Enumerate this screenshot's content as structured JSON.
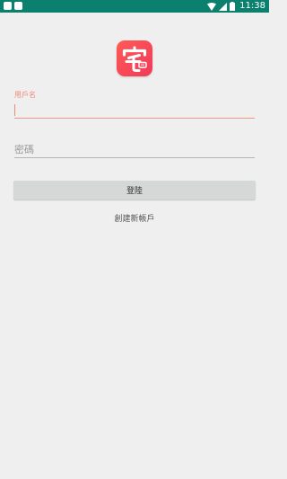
{
  "status_bar": {
    "time": "11:38",
    "icons": [
      "notification-icon",
      "notification-icon",
      "wifi-icon",
      "signal-icon",
      "battery-icon"
    ],
    "color": "#0b806f"
  },
  "logo": {
    "glyph": "宅",
    "icon": "app-logo-icon",
    "colors": [
      "#ff5a55",
      "#f03a5a"
    ]
  },
  "login_form": {
    "username_label": "用戶名",
    "username_value": "",
    "password_placeholder": "密碼",
    "password_value": "",
    "login_button_label": "登陸",
    "create_account_label": "創建新帳戶"
  },
  "colors": {
    "accent": "#f08a74",
    "background": "#efefef",
    "button": "#d6d7d7"
  }
}
